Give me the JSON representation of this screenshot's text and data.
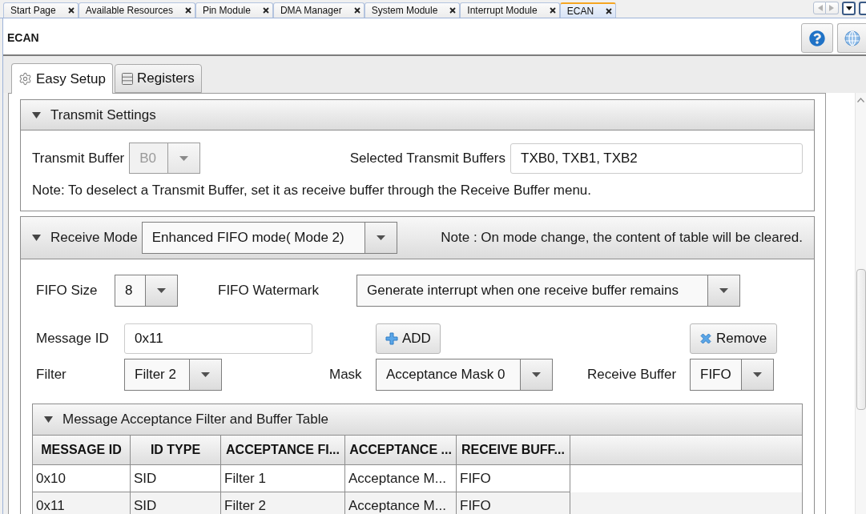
{
  "doc_tabs": [
    {
      "label": "Start Page",
      "selected": false
    },
    {
      "label": "Available Resources",
      "selected": false
    },
    {
      "label": "Pin Module",
      "selected": false
    },
    {
      "label": "DMA Manager",
      "selected": false
    },
    {
      "label": "System Module",
      "selected": false
    },
    {
      "label": "Interrupt Module",
      "selected": false
    },
    {
      "label": "ECAN",
      "selected": true
    }
  ],
  "header": {
    "title": "ECAN"
  },
  "view_tabs": [
    {
      "label": "Easy Setup",
      "selected": true
    },
    {
      "label": "Registers",
      "selected": false
    }
  ],
  "transmit_settings": {
    "title": "Transmit Settings",
    "expanded": true,
    "transmit_buffer": {
      "label": "Transmit Buffer",
      "value": "B0",
      "disabled": true
    },
    "selected_buffers": {
      "label": "Selected Transmit Buffers",
      "value": "TXB0, TXB1, TXB2"
    },
    "note": "Note: To deselect a Transmit Buffer, set it as receive buffer through the Receive Buffer menu."
  },
  "receive_settings": {
    "label": "Receive Mode",
    "expanded": true,
    "mode": "Enhanced FIFO mode( Mode 2)",
    "note": "Note : On mode change, the content of table will be cleared.",
    "fifo_size": {
      "label": "FIFO Size",
      "value": "8"
    },
    "fifo_watermark": {
      "label": "FIFO Watermark",
      "value": "Generate interrupt when one receive buffer remains"
    },
    "message_id": {
      "label": "Message ID",
      "value": "0x11"
    },
    "add_button": "ADD",
    "remove_button": "Remove",
    "filter": {
      "label": "Filter",
      "value": "Filter 2"
    },
    "mask": {
      "label": "Mask",
      "value": "Acceptance Mask 0"
    },
    "receive_buffer": {
      "label": "Receive Buffer",
      "value": "FIFO"
    }
  },
  "filter_table": {
    "title": "Message Acceptance Filter and Buffer Table",
    "expanded": true,
    "columns": [
      "MESSAGE ID",
      "ID TYPE",
      "ACCEPTANCE FI...",
      "ACCEPTANCE ...",
      "RECEIVE BUFF..."
    ],
    "rows": [
      [
        "0x10",
        "SID",
        "Filter 1",
        "Acceptance M...",
        "FIFO"
      ],
      [
        "0x11",
        "SID",
        "Filter 2",
        "Acceptance M...",
        "FIFO"
      ]
    ]
  }
}
